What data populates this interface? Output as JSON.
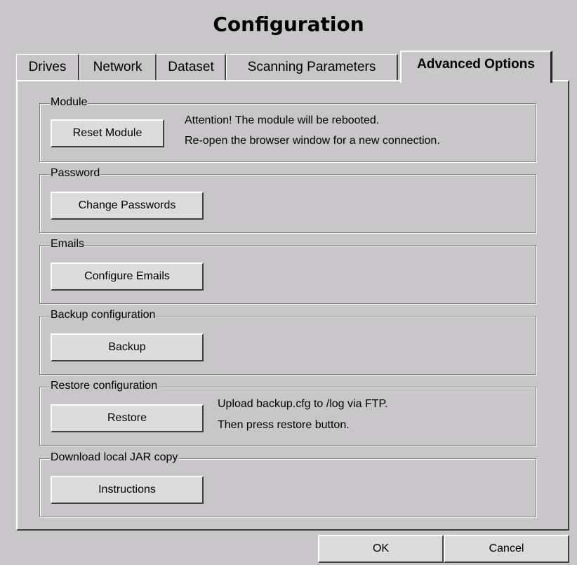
{
  "title": "Configuration",
  "tabs": [
    {
      "label": "Drives",
      "active": false
    },
    {
      "label": "Network",
      "active": false
    },
    {
      "label": "Dataset",
      "active": false
    },
    {
      "label": "Scanning Parameters",
      "active": false
    },
    {
      "label": "Advanced Options",
      "active": true
    }
  ],
  "groups": {
    "module": {
      "label": "Module",
      "button": "Reset Module",
      "note_line1": "Attention! The module will be rebooted.",
      "note_line2": "Re-open the browser window for a new connection."
    },
    "password": {
      "label": "Password",
      "button": "Change Passwords"
    },
    "emails": {
      "label": "Emails",
      "button": "Configure Emails"
    },
    "backup": {
      "label": "Backup configuration",
      "button": "Backup"
    },
    "restore": {
      "label": "Restore configuration",
      "button": "Restore",
      "note_line1": "Upload backup.cfg to /log via FTP.",
      "note_line2": "Then press restore button."
    },
    "jar": {
      "label": "Download local JAR copy",
      "button": "Instructions"
    }
  },
  "footer": {
    "ok": "OK",
    "cancel": "Cancel"
  }
}
